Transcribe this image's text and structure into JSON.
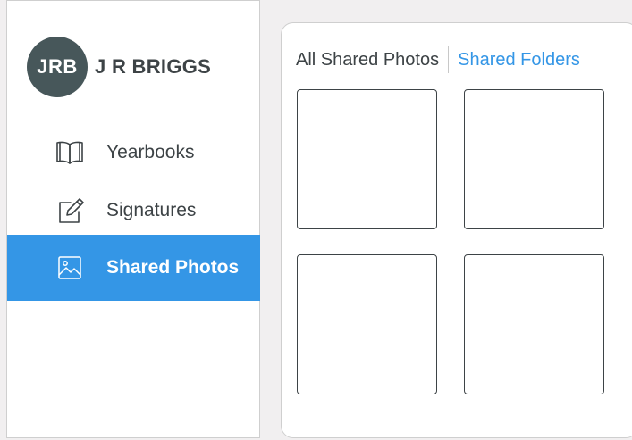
{
  "user": {
    "initials": "JRB",
    "name": "J R BRIGGS"
  },
  "sidebar": {
    "items": [
      {
        "label": "Yearbooks",
        "icon": "book-icon",
        "active": false
      },
      {
        "label": "Signatures",
        "icon": "pen-square-icon",
        "active": false
      },
      {
        "label": "Shared Photos",
        "icon": "image-icon",
        "active": true
      }
    ]
  },
  "main": {
    "tabs": [
      {
        "label": "All Shared Photos",
        "active": true
      },
      {
        "label": "Shared Folders",
        "active": false
      }
    ],
    "photo_count": 4
  },
  "colors": {
    "accent": "#3496e6",
    "avatar_bg": "#47575a",
    "text": "#3d4346",
    "background": "#f1eff0"
  }
}
